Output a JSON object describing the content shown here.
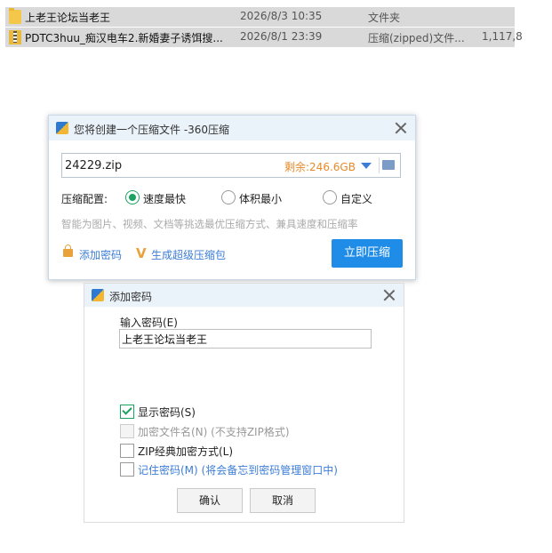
{
  "files": [
    {
      "icon": "folder-icon",
      "name": "上老王论坛当老王",
      "date": "2026/8/3 10:35",
      "type": "文件夹",
      "size": ""
    },
    {
      "icon": "zip-file-icon",
      "name": "PDTC3huu_痴汉电车2.新婚妻子诱饵搜...",
      "date": "2026/8/1 23:39",
      "type": "压缩(zipped)文件...",
      "size": "1,117,8"
    }
  ],
  "compress_dialog": {
    "title": "您将创建一个压缩文件 -360压缩",
    "filename": "24229.zip",
    "remaining": "剩余:246.6GB",
    "config_label": "压缩配置:",
    "options": [
      "速度最快",
      "体积最小",
      "自定义"
    ],
    "selected_option": "速度最快",
    "hint": "智能为图片、视频、文档等挑选最优压缩方式、兼具速度和压缩率",
    "add_password": "添加密码",
    "super_zip": "生成超级压缩包",
    "compress_button": "立即压缩"
  },
  "password_dialog": {
    "title": "添加密码",
    "input_label": "输入密码(E)",
    "password_value": "上老王论坛当老王",
    "checkboxes": [
      {
        "label": "显示密码(S)",
        "checked": true,
        "enabled": true
      },
      {
        "label": "加密文件名(N) (不支持ZIP格式)",
        "checked": false,
        "enabled": false
      },
      {
        "label": "ZIP经典加密方式(L)",
        "checked": false,
        "enabled": true
      },
      {
        "label": "记住密码(M) (将会备忘到密码管理窗口中)",
        "checked": false,
        "enabled": true
      }
    ],
    "ok_button": "确认",
    "cancel_button": "取消"
  },
  "colors": {
    "accent": "#1f8ce8",
    "selected_green": "#1aa260",
    "remaining_orange": "#e88a2a",
    "link_blue": "#3d7dd6"
  }
}
